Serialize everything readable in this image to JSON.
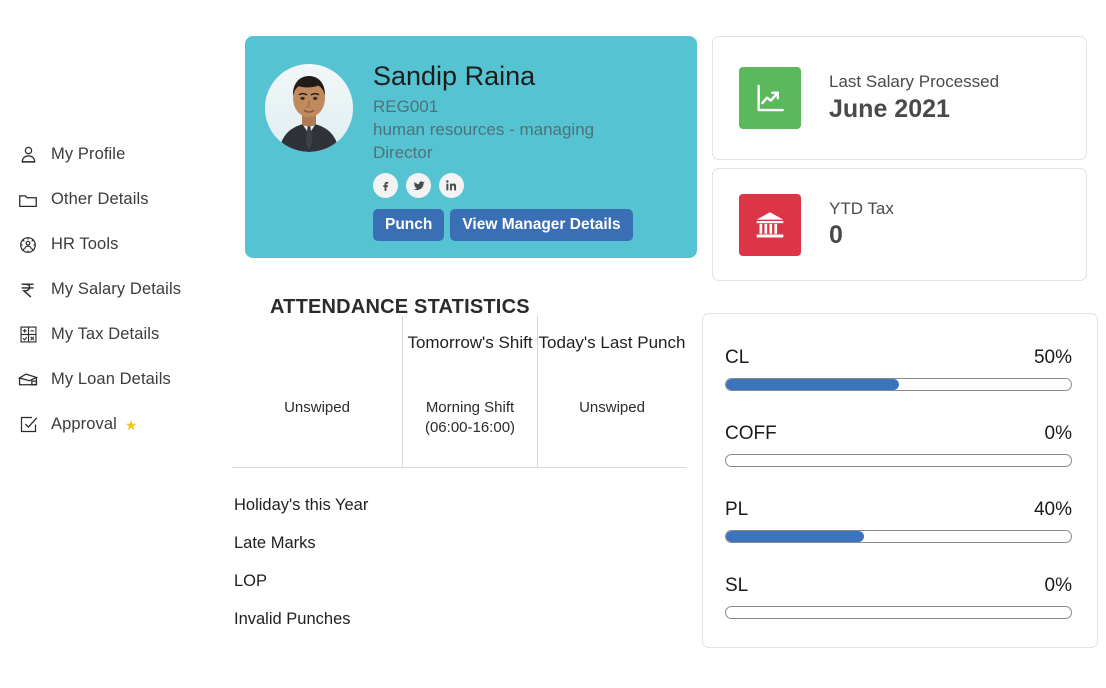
{
  "sidebar": {
    "items": [
      {
        "label": "My Profile",
        "icon": "person-icon",
        "star": false
      },
      {
        "label": "Other Details",
        "icon": "folder-icon",
        "star": false
      },
      {
        "label": "HR Tools",
        "icon": "hr-tools-icon",
        "star": false
      },
      {
        "label": "My Salary Details",
        "icon": "rupee-icon",
        "star": false
      },
      {
        "label": "My Tax Details",
        "icon": "calculator-icon",
        "star": false
      },
      {
        "label": "My Loan Details",
        "icon": "loan-card-icon",
        "star": false
      },
      {
        "label": "Approval",
        "icon": "approval-icon",
        "star": true,
        "star_glyph": "★"
      }
    ]
  },
  "profile": {
    "name": "Sandip Raina",
    "employee_code": "REG001",
    "designation": "human resources - managing Director",
    "avatar_alt": "employee-photo",
    "card_color": "#55c3d2",
    "socials": [
      {
        "name": "facebook-icon",
        "glyph": "f"
      },
      {
        "name": "twitter-icon",
        "glyph": "t"
      },
      {
        "name": "linkedin-icon",
        "glyph": "in"
      }
    ],
    "buttons": [
      {
        "label": "Punch",
        "name": "punch-button"
      },
      {
        "label": "View Manager Details",
        "name": "view-manager-details-button"
      }
    ],
    "button_color": "#3b6fb5"
  },
  "attendance": {
    "title": "ATTENDANCE STATISTICS",
    "columns": [
      {
        "header": "",
        "value": "Unswiped"
      },
      {
        "header": "Tomorrow's Shift",
        "value": "Morning Shift (06:00-16:00)"
      },
      {
        "header": "Today's Last Punch",
        "value": "Unswiped"
      }
    ],
    "stats": [
      {
        "label": "Holiday's this Year"
      },
      {
        "label": "Late Marks"
      },
      {
        "label": "LOP"
      },
      {
        "label": "Invalid Punches"
      }
    ]
  },
  "kpis": [
    {
      "label": "Last Salary Processed",
      "value": "June 2021",
      "icon": "chart-growth-icon",
      "color": "#5cb85c"
    },
    {
      "label": "YTD Tax",
      "value": "0",
      "icon": "bank-icon",
      "color": "#dd3447"
    }
  ],
  "leave_balances": {
    "accent_color": "#3b74bd",
    "rows": [
      {
        "name": "CL",
        "percent_label": "50%",
        "percent": 50
      },
      {
        "name": "COFF",
        "percent_label": "0%",
        "percent": 0
      },
      {
        "name": "PL",
        "percent_label": "40%",
        "percent": 40
      },
      {
        "name": "SL",
        "percent_label": "0%",
        "percent": 0
      }
    ]
  }
}
